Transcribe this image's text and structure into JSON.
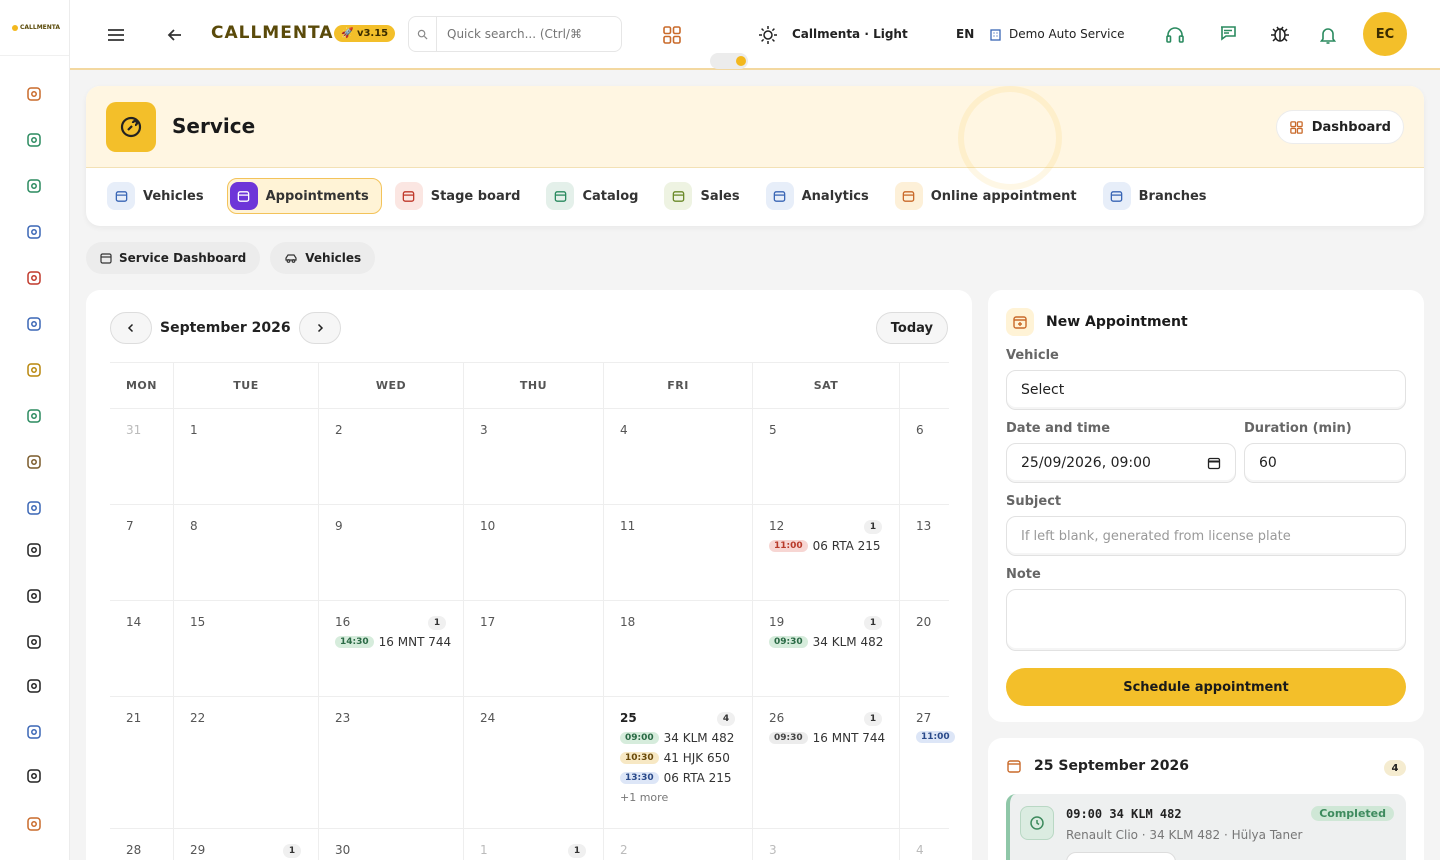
{
  "app": {
    "logo_text": "CALLMENTA",
    "brand": "CALLMENTA",
    "version": "v3.15"
  },
  "search": {
    "placeholder": "Quick search... (Ctrl/⌘"
  },
  "topbar": {
    "theme_label": "Callmenta · Light",
    "language": "EN",
    "company": "Demo Auto Service",
    "avatar_initials": "EC"
  },
  "sidebar": {
    "icons": [
      "dashboard-icon",
      "tasks-icon",
      "inbox-icon",
      "contacts-icon",
      "clock-icon",
      "team-icon",
      "trophy-icon",
      "megaphone-icon",
      "gear-icon",
      "users-icon",
      "call-incoming-icon",
      "service-icon",
      "car-icon",
      "tag-icon",
      "hierarchy-icon",
      "shield-icon",
      "grid-icon"
    ]
  },
  "page": {
    "title": "Service",
    "dashboard_button": "Dashboard"
  },
  "tabs": [
    {
      "label": "Vehicles",
      "icon": "car-icon",
      "active": false
    },
    {
      "label": "Appointments",
      "icon": "calendar-icon",
      "active": true
    },
    {
      "label": "Stage board",
      "icon": "board-icon",
      "active": false
    },
    {
      "label": "Catalog",
      "icon": "list-icon",
      "active": false
    },
    {
      "label": "Sales",
      "icon": "tag-icon",
      "active": false
    },
    {
      "label": "Analytics",
      "icon": "chart-icon",
      "active": false
    },
    {
      "label": "Online appointment",
      "icon": "calendar-icon",
      "active": false
    },
    {
      "label": "Branches",
      "icon": "store-icon",
      "active": false
    }
  ],
  "subtabs": [
    {
      "label": "Service Dashboard"
    },
    {
      "label": "Vehicles"
    }
  ],
  "calendar": {
    "month": "September 2026",
    "today_label": "Today",
    "days": [
      "MON",
      "TUE",
      "WED",
      "THU",
      "FRI",
      "SAT"
    ],
    "weeks": [
      [
        {
          "d": "31",
          "other": true
        },
        {
          "d": "1"
        },
        {
          "d": "2"
        },
        {
          "d": "3"
        },
        {
          "d": "4"
        },
        {
          "d": "5"
        },
        {
          "d": "6"
        }
      ],
      [
        {
          "d": "7"
        },
        {
          "d": "8"
        },
        {
          "d": "9"
        },
        {
          "d": "10"
        },
        {
          "d": "11"
        },
        {
          "d": "12",
          "count": "1",
          "events": [
            {
              "t": "11:00",
              "p": "06 RTA 215",
              "c": "red"
            }
          ]
        },
        {
          "d": "13"
        }
      ],
      [
        {
          "d": "14"
        },
        {
          "d": "15"
        },
        {
          "d": "16",
          "count": "1",
          "events": [
            {
              "t": "14:30",
              "p": "16 MNT 744",
              "c": "green"
            }
          ]
        },
        {
          "d": "17"
        },
        {
          "d": "18"
        },
        {
          "d": "19",
          "count": "1",
          "events": [
            {
              "t": "09:30",
              "p": "34 KLM 482",
              "c": "green"
            }
          ]
        },
        {
          "d": "20"
        }
      ],
      [
        {
          "d": "21"
        },
        {
          "d": "22"
        },
        {
          "d": "23"
        },
        {
          "d": "24"
        },
        {
          "d": "25",
          "bold": true,
          "count": "4",
          "events": [
            {
              "t": "09:00",
              "p": "34 KLM 482",
              "c": "green"
            },
            {
              "t": "10:30",
              "p": "41 HJK 650",
              "c": "yellow"
            },
            {
              "t": "13:30",
              "p": "06 RTA 215",
              "c": "blue"
            }
          ],
          "more": "+1 more"
        },
        {
          "d": "26",
          "count": "1",
          "events": [
            {
              "t": "09:30",
              "p": "16 MNT 744",
              "c": "grey"
            }
          ]
        },
        {
          "d": "27",
          "events": [
            {
              "t": "11:00",
              "p": "",
              "c": "blue"
            }
          ]
        }
      ],
      [
        {
          "d": "28"
        },
        {
          "d": "29",
          "count": "1"
        },
        {
          "d": "30"
        },
        {
          "d": "1",
          "other": true,
          "count": "1"
        },
        {
          "d": "2",
          "other": true
        },
        {
          "d": "3",
          "other": true
        },
        {
          "d": "4",
          "other": true
        }
      ]
    ]
  },
  "new_appointment": {
    "title": "New Appointment",
    "vehicle_label": "Vehicle",
    "vehicle_value": "Select",
    "datetime_label": "Date and time",
    "datetime_value": "25/09/2026, 09:00",
    "duration_label": "Duration (min)",
    "duration_value": "60",
    "subject_label": "Subject",
    "subject_placeholder": "If left blank, generated from license plate",
    "note_label": "Note",
    "submit_label": "Schedule appointment"
  },
  "day_panel": {
    "title": "25 September 2026",
    "count": "4",
    "appointment": {
      "time": "09:00",
      "plate": "34 KLM 482",
      "detail": "Renault Clio · 34 KLM 482 · Hülya Taner",
      "status": "Completed"
    }
  },
  "colors": {
    "accent": "#f3bf2a",
    "active_tab": "#6d35d8"
  }
}
